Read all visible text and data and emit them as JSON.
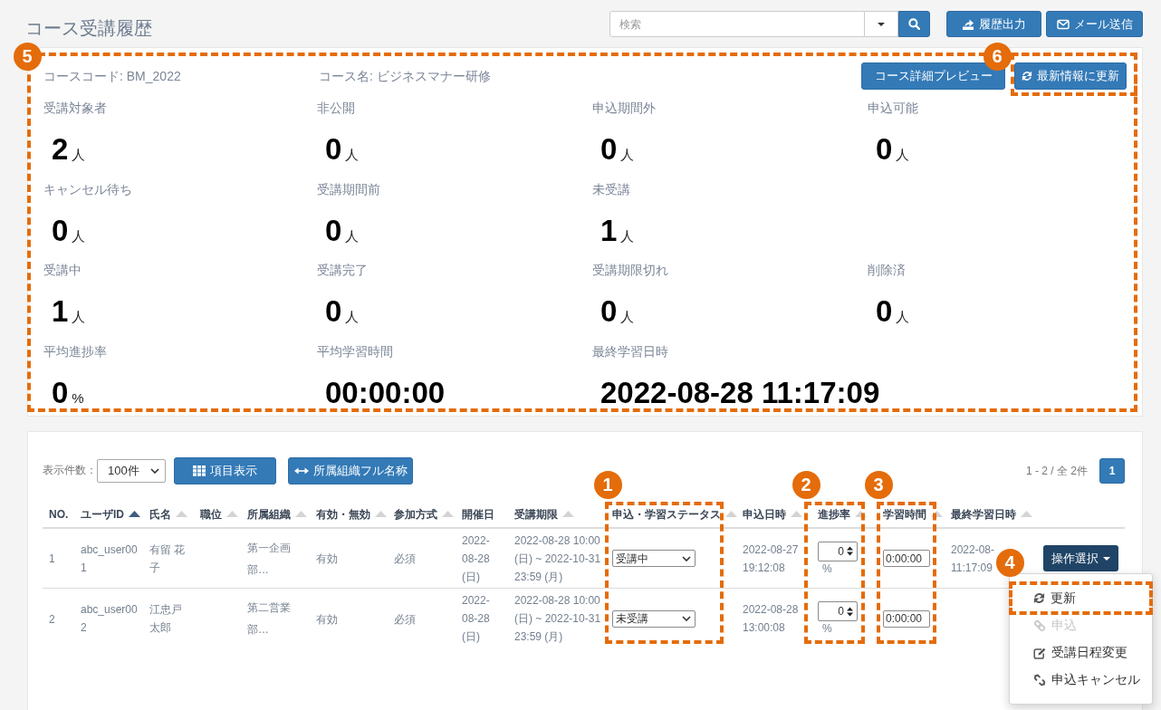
{
  "page": {
    "title": "コース受講履歴"
  },
  "search": {
    "placeholder": "検索"
  },
  "export_button": {
    "label": "履歴出力"
  },
  "mail_button": {
    "label": "メール送信"
  },
  "summary": {
    "callout": "5",
    "course_code": "コースコード: BM_2022",
    "course_name": "コース名: ビジネスマナー研修",
    "preview_button": {
      "label": "コース詳細プレビュー"
    },
    "refresh_button": {
      "label": "最新情報に更新",
      "callout": "6"
    },
    "stat_rows": [
      [
        {
          "label": "受講対象者",
          "value": "2",
          "unit": "人"
        },
        {
          "label": "非公開",
          "value": "0",
          "unit": "人"
        },
        {
          "label": "申込期間外",
          "value": "0",
          "unit": "人"
        },
        {
          "label": "申込可能",
          "value": "0",
          "unit": "人"
        }
      ],
      [
        {
          "label": "キャンセル待ち",
          "value": "0",
          "unit": "人"
        },
        {
          "label": "受講期間前",
          "value": "0",
          "unit": "人"
        },
        {
          "label": "未受講",
          "value": "1",
          "unit": "人"
        }
      ],
      [
        {
          "label": "受講中",
          "value": "1",
          "unit": "人"
        },
        {
          "label": "受講完了",
          "value": "0",
          "unit": "人"
        },
        {
          "label": "受講期限切れ",
          "value": "0",
          "unit": "人"
        },
        {
          "label": "削除済",
          "value": "0",
          "unit": "人"
        }
      ],
      [
        {
          "label": "平均進捗率",
          "value": "0",
          "unit": "%"
        },
        {
          "label": "平均学習時間",
          "value": "00:00:00"
        },
        {
          "label": "最終学習日時",
          "value": "2022-08-28 11:17:09"
        }
      ]
    ]
  },
  "list": {
    "page_size_label": "表示件数：",
    "page_size": "100件",
    "columns_button": {
      "label": "項目表示"
    },
    "org_name_button": {
      "label": "所属組織フル名称"
    },
    "range": "1 - 2 / 全 2件",
    "pages": [
      {
        "label": "1",
        "selected": true
      }
    ],
    "columns": [
      {
        "label": "NO.",
        "sortable": false
      },
      {
        "label": "ユーザID",
        "sortable": true,
        "sorted": true
      },
      {
        "label": "氏名",
        "sortable": true,
        "sorted": false
      },
      {
        "label": "職位",
        "sortable": true,
        "sorted": false
      },
      {
        "label": "所属組織",
        "sortable": true,
        "sorted": false
      },
      {
        "label": "有効・無効",
        "sortable": true,
        "sorted": false
      },
      {
        "label": "参加方式",
        "sortable": true,
        "sorted": false
      },
      {
        "label": "開催日",
        "sortable": false
      },
      {
        "label": "受講期限",
        "sortable": true,
        "sorted": false
      },
      {
        "label": "申込・学習ステータス",
        "sortable": true,
        "sorted": false,
        "callout": "1"
      },
      {
        "label": "申込日時",
        "sortable": true,
        "sorted": false
      },
      {
        "label": "進捗率",
        "sortable": true,
        "sorted": false,
        "callout": "2"
      },
      {
        "label": "学習時間",
        "sortable": true,
        "sorted": false,
        "callout": "3"
      },
      {
        "label": "最終学習日時",
        "sortable": true,
        "sorted": false
      }
    ],
    "rows": [
      {
        "no": "1",
        "user_id": "abc_user001",
        "name": "有留 花子",
        "organization": "第一企画部…",
        "validity": "有効",
        "participation": "必須",
        "held_on": "2022-08-28 (日)",
        "period": "2022-08-28 10:00 (日) ~ 2022-10-31 23:59 (月)",
        "status": "受講中",
        "applied_at": "2022-08-27 19:12:08",
        "progress": "0",
        "progress_unit": "%",
        "study_time": "0:00:00",
        "last_studied": "2022-08- 11:17:09",
        "action": {
          "label": "操作選択",
          "menu": [
            {
              "label": "更新",
              "kind": "refresh",
              "disabled": false,
              "callout": "4"
            },
            {
              "label": "申込",
              "kind": "link",
              "disabled": true
            },
            {
              "label": "受講日程変更",
              "kind": "edit",
              "disabled": false
            },
            {
              "label": "申込キャンセル",
              "kind": "unlink",
              "disabled": false
            }
          ]
        }
      },
      {
        "no": "2",
        "user_id": "abc_user002",
        "name": "江忠戸太郎",
        "organization": "第二営業部…",
        "validity": "有効",
        "participation": "必須",
        "held_on": "2022-08-28 (日)",
        "period": "2022-08-28 10:00 (日) ~ 2022-10-31 23:59 (月)",
        "status": "未受講",
        "applied_at": "2022-08-28 13:00:08",
        "progress": "0",
        "progress_unit": "%",
        "study_time": "0:00:00"
      }
    ]
  }
}
